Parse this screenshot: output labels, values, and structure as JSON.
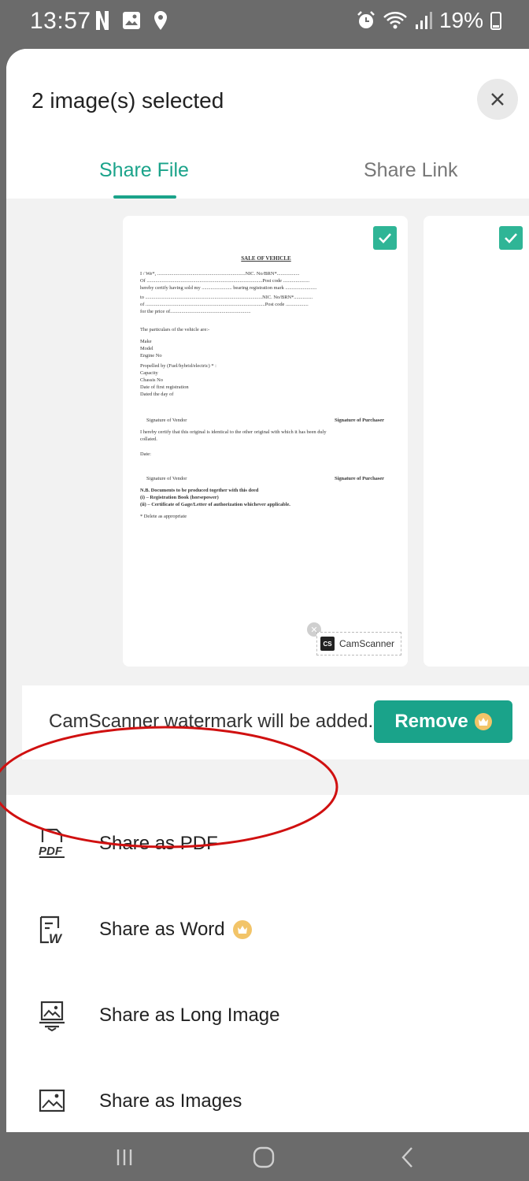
{
  "status_bar": {
    "time": "13:57",
    "battery": "19%"
  },
  "sheet": {
    "title": "2 image(s) selected",
    "tabs": [
      {
        "label": "Share File",
        "active": true
      },
      {
        "label": "Share Link",
        "active": false
      }
    ]
  },
  "preview": {
    "pages_selected": [
      true,
      true
    ],
    "document": {
      "title": "SALE OF VEHICLE",
      "lines": [
        "I / We*, ......................................................................NIC. No/BRN*..................",
        "Of ............................................................................................Post code .....................",
        "hereby certify having sold my ........................ bearing registration mark .........................",
        "to .............................................................................................NIC. No/BRN*...............",
        "of ...............................................................................................Post code ..................",
        "for the price of................................................................"
      ],
      "particulars_heading": "The particulars of the vehicle are:-",
      "fields_a": [
        "Make",
        "Model",
        "Engine No"
      ],
      "propelled": "Propelled by (Fuel/hybrid/electric) * :",
      "fields_b": [
        "Capacity",
        "Chassis No",
        "Date of first registration",
        "Dated the                    day of"
      ],
      "sig_vendor": "Signature of Vendor",
      "sig_purchaser": "Signature of Purchaser",
      "certify": "I hereby certify that this original is identical to the other original with which it has been duly",
      "certify_2": "collated.",
      "date_label": "Date:",
      "nb_lines": [
        "N.B.  Documents to be produced together with this deed",
        "(i)  – Registration Book (horsepower)",
        "(ii) – Certificate of Gage/Letter of authorization whichever applicable."
      ],
      "footnote": "* Delete as appropriate"
    },
    "watermark_brand": "CamScanner",
    "watermark_logo": "CS"
  },
  "watermark_notice": {
    "text": "CamScanner watermark will be added.",
    "remove_label": "Remove"
  },
  "options": [
    {
      "label": "Share as PDF",
      "icon": "pdf-icon",
      "premium": false
    },
    {
      "label": "Share as Word",
      "icon": "word-icon",
      "premium": true
    },
    {
      "label": "Share as Long Image",
      "icon": "long-image-icon",
      "premium": false
    },
    {
      "label": "Share as Images",
      "icon": "images-icon",
      "premium": false
    }
  ],
  "colors": {
    "accent": "#1aa38a",
    "highlight": "#d01010",
    "premium": "#f2c468"
  }
}
